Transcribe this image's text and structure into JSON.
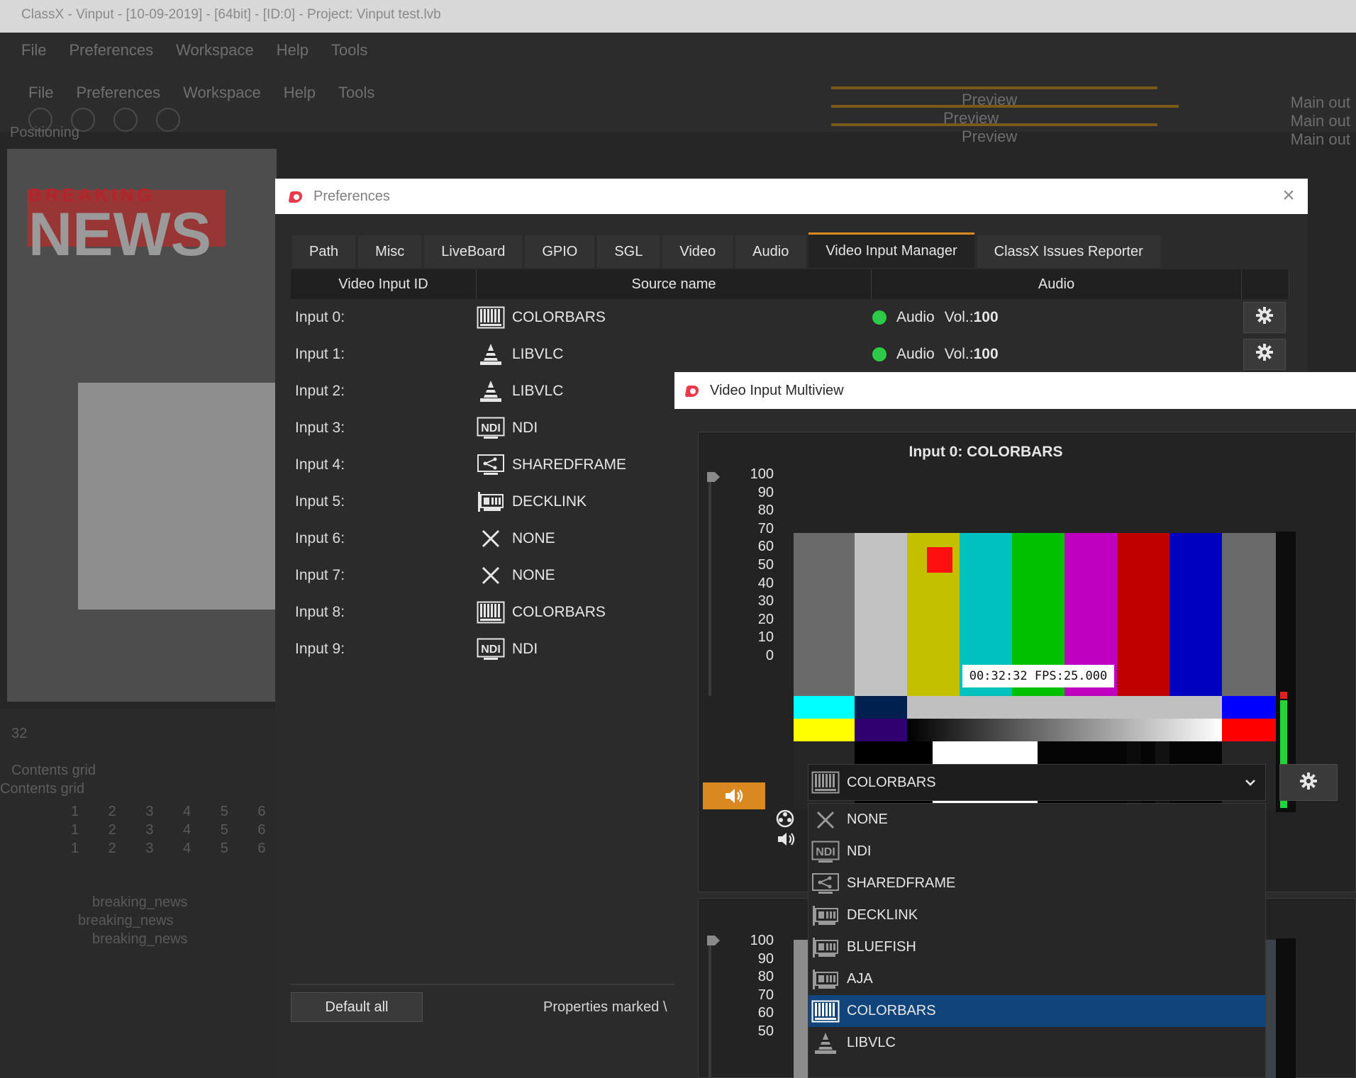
{
  "background": {
    "titlebar_text": "ClassX - Vinput - [10-09-2019] - [64bit] - [ID:0] - Project: Vinput test.lvb",
    "menu": [
      "File",
      "Preferences",
      "Workspace",
      "Help",
      "Tools"
    ],
    "positioning_label": "Positioning",
    "preview_label": "Preview",
    "main_out_label": "Main out",
    "breaking_text": "BREAKING",
    "news_text": "NEWS",
    "contents_grid_label": "Contents grid",
    "grid_numbers": "1 2 3 4 5 6 7 8",
    "layer_item": "breaking_news",
    "spin_value": "32"
  },
  "preferences": {
    "title": "Preferences",
    "tabs": [
      "Path",
      "Misc",
      "LiveBoard",
      "GPIO",
      "SGL",
      "Video",
      "Audio",
      "Video Input Manager",
      "ClassX Issues Reporter"
    ],
    "active_tab": "Video Input Manager",
    "columns": {
      "id": "Video Input ID",
      "source": "Source name",
      "audio": "Audio"
    },
    "rows": [
      {
        "id": "Input 0:",
        "source": "COLORBARS",
        "icon": "colorbars-icon",
        "audio": "Audio",
        "vol_label": "Vol.:",
        "vol": "100"
      },
      {
        "id": "Input 1:",
        "source": "LIBVLC",
        "icon": "vlc-cone-icon",
        "audio": "Audio",
        "vol_label": "Vol.:",
        "vol": "100"
      },
      {
        "id": "Input 2:",
        "source": "LIBVLC",
        "icon": "vlc-cone-icon"
      },
      {
        "id": "Input 3:",
        "source": "NDI",
        "icon": "ndi-icon"
      },
      {
        "id": "Input 4:",
        "source": "SHAREDFRAME",
        "icon": "sharedframe-icon"
      },
      {
        "id": "Input 5:",
        "source": "DECKLINK",
        "icon": "capture-card-icon"
      },
      {
        "id": "Input 6:",
        "source": "NONE",
        "icon": "x-icon"
      },
      {
        "id": "Input 7:",
        "source": "NONE",
        "icon": "x-icon"
      },
      {
        "id": "Input 8:",
        "source": "COLORBARS",
        "icon": "colorbars-icon"
      },
      {
        "id": "Input 9:",
        "source": "NDI",
        "icon": "ndi-icon"
      }
    ],
    "default_all_label": "Default all",
    "properties_note": "Properties marked \\"
  },
  "multiview": {
    "title": "Video Input Multiview",
    "panel_title": "Input 0: COLORBARS",
    "scale": [
      "100",
      "90",
      "80",
      "70",
      "60",
      "50",
      "40",
      "30",
      "20",
      "10",
      "0"
    ],
    "scale2": [
      "100",
      "90",
      "80",
      "70",
      "60",
      "50"
    ],
    "timecode": "00:32:32 FPS:25.000",
    "vu_level": 0.4,
    "selected_source": "COLORBARS",
    "dropdown_options": [
      {
        "label": "NONE",
        "icon": "x-icon"
      },
      {
        "label": "NDI",
        "icon": "ndi-icon"
      },
      {
        "label": "SHAREDFRAME",
        "icon": "sharedframe-icon"
      },
      {
        "label": "DECKLINK",
        "icon": "capture-card-icon"
      },
      {
        "label": "BLUEFISH",
        "icon": "capture-card-icon"
      },
      {
        "label": "AJA",
        "icon": "capture-card-icon"
      },
      {
        "label": "COLORBARS",
        "icon": "colorbars-icon",
        "selected": true
      },
      {
        "label": "LIBVLC",
        "icon": "vlc-cone-icon"
      }
    ]
  },
  "colors": {
    "accent": "#d9891f",
    "selection": "#11447a",
    "audio_ok": "#2fc94a",
    "logo": "#e83a4a"
  }
}
